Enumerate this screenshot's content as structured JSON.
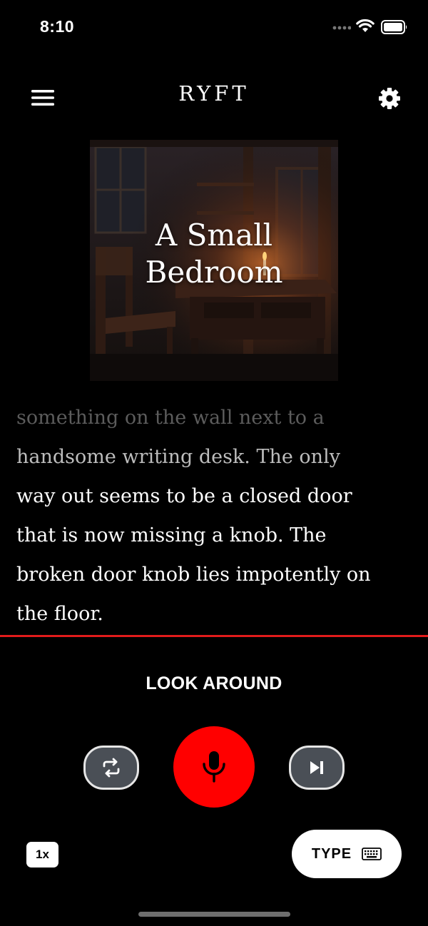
{
  "status_bar": {
    "time": "8:10"
  },
  "header": {
    "title": "RYFT",
    "menu_icon": "hamburger-menu-icon",
    "settings_icon": "gear-icon"
  },
  "scene": {
    "title_line1": "A Small",
    "title_line2": "Bedroom"
  },
  "story": {
    "lines": [
      {
        "text": "something on the wall next to a",
        "color": "#5c5c5c"
      },
      {
        "text": "handsome writing desk. The only",
        "color": "#bdbdbd"
      },
      {
        "text": "way out seems to be a closed door",
        "color": "#ffffff"
      },
      {
        "text": "that is now missing a knob. The",
        "color": "#ffffff"
      },
      {
        "text": "broken door knob lies impotently on",
        "color": "#ffffff"
      },
      {
        "text": "the floor.",
        "color": "#ffffff"
      }
    ]
  },
  "action": {
    "label": "LOOK AROUND"
  },
  "controls": {
    "repeat_icon": "repeat-icon",
    "mic_icon": "microphone-icon",
    "skip_icon": "skip-next-icon",
    "speed_label": "1x",
    "type_label": "TYPE",
    "keyboard_icon": "keyboard-icon"
  },
  "colors": {
    "accent": "#ff0000",
    "divider": "#e21b1b",
    "background": "#000000",
    "control_button": "#4a4f56"
  }
}
